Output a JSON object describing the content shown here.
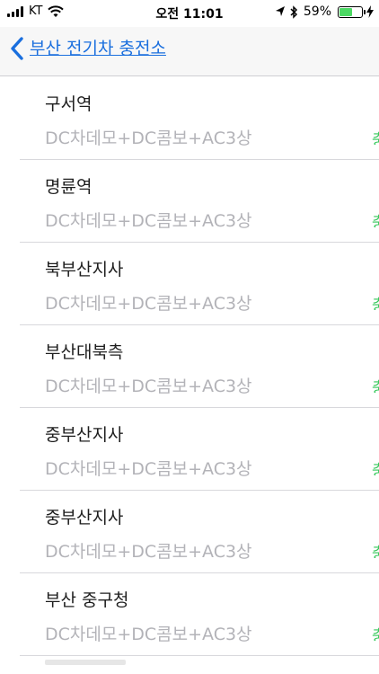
{
  "status_bar": {
    "carrier": "KT",
    "time": "오전 11:01",
    "battery_percent": "59%",
    "battery_level": 0.59,
    "icons": [
      "signal-icon",
      "wifi-icon",
      "location-arrow-icon",
      "bluetooth-icon",
      "battery-icon",
      "charging-bolt-icon"
    ]
  },
  "nav": {
    "back_label": "부산 전기차 충전소"
  },
  "stations": [
    {
      "name": "구서역",
      "type": "DC차데모+DC콤보+AC3상",
      "status": "충"
    },
    {
      "name": "명륜역",
      "type": "DC차데모+DC콤보+AC3상",
      "status": "충"
    },
    {
      "name": "북부산지사",
      "type": "DC차데모+DC콤보+AC3상",
      "status": "충"
    },
    {
      "name": "부산대북측",
      "type": "DC차데모+DC콤보+AC3상",
      "status": "충"
    },
    {
      "name": "중부산지사",
      "type": "DC차데모+DC콤보+AC3상",
      "status": "충"
    },
    {
      "name": "중부산지사",
      "type": "DC차데모+DC콤보+AC3상",
      "status": "충"
    },
    {
      "name": "부산 중구청",
      "type": "DC차데모+DC콤보+AC3상",
      "status": "충"
    }
  ],
  "colors": {
    "accent": "#1a6fde",
    "status_green": "#34c759",
    "subtitle_gray": "#b3b3b8",
    "battery_green": "#4cd964"
  }
}
